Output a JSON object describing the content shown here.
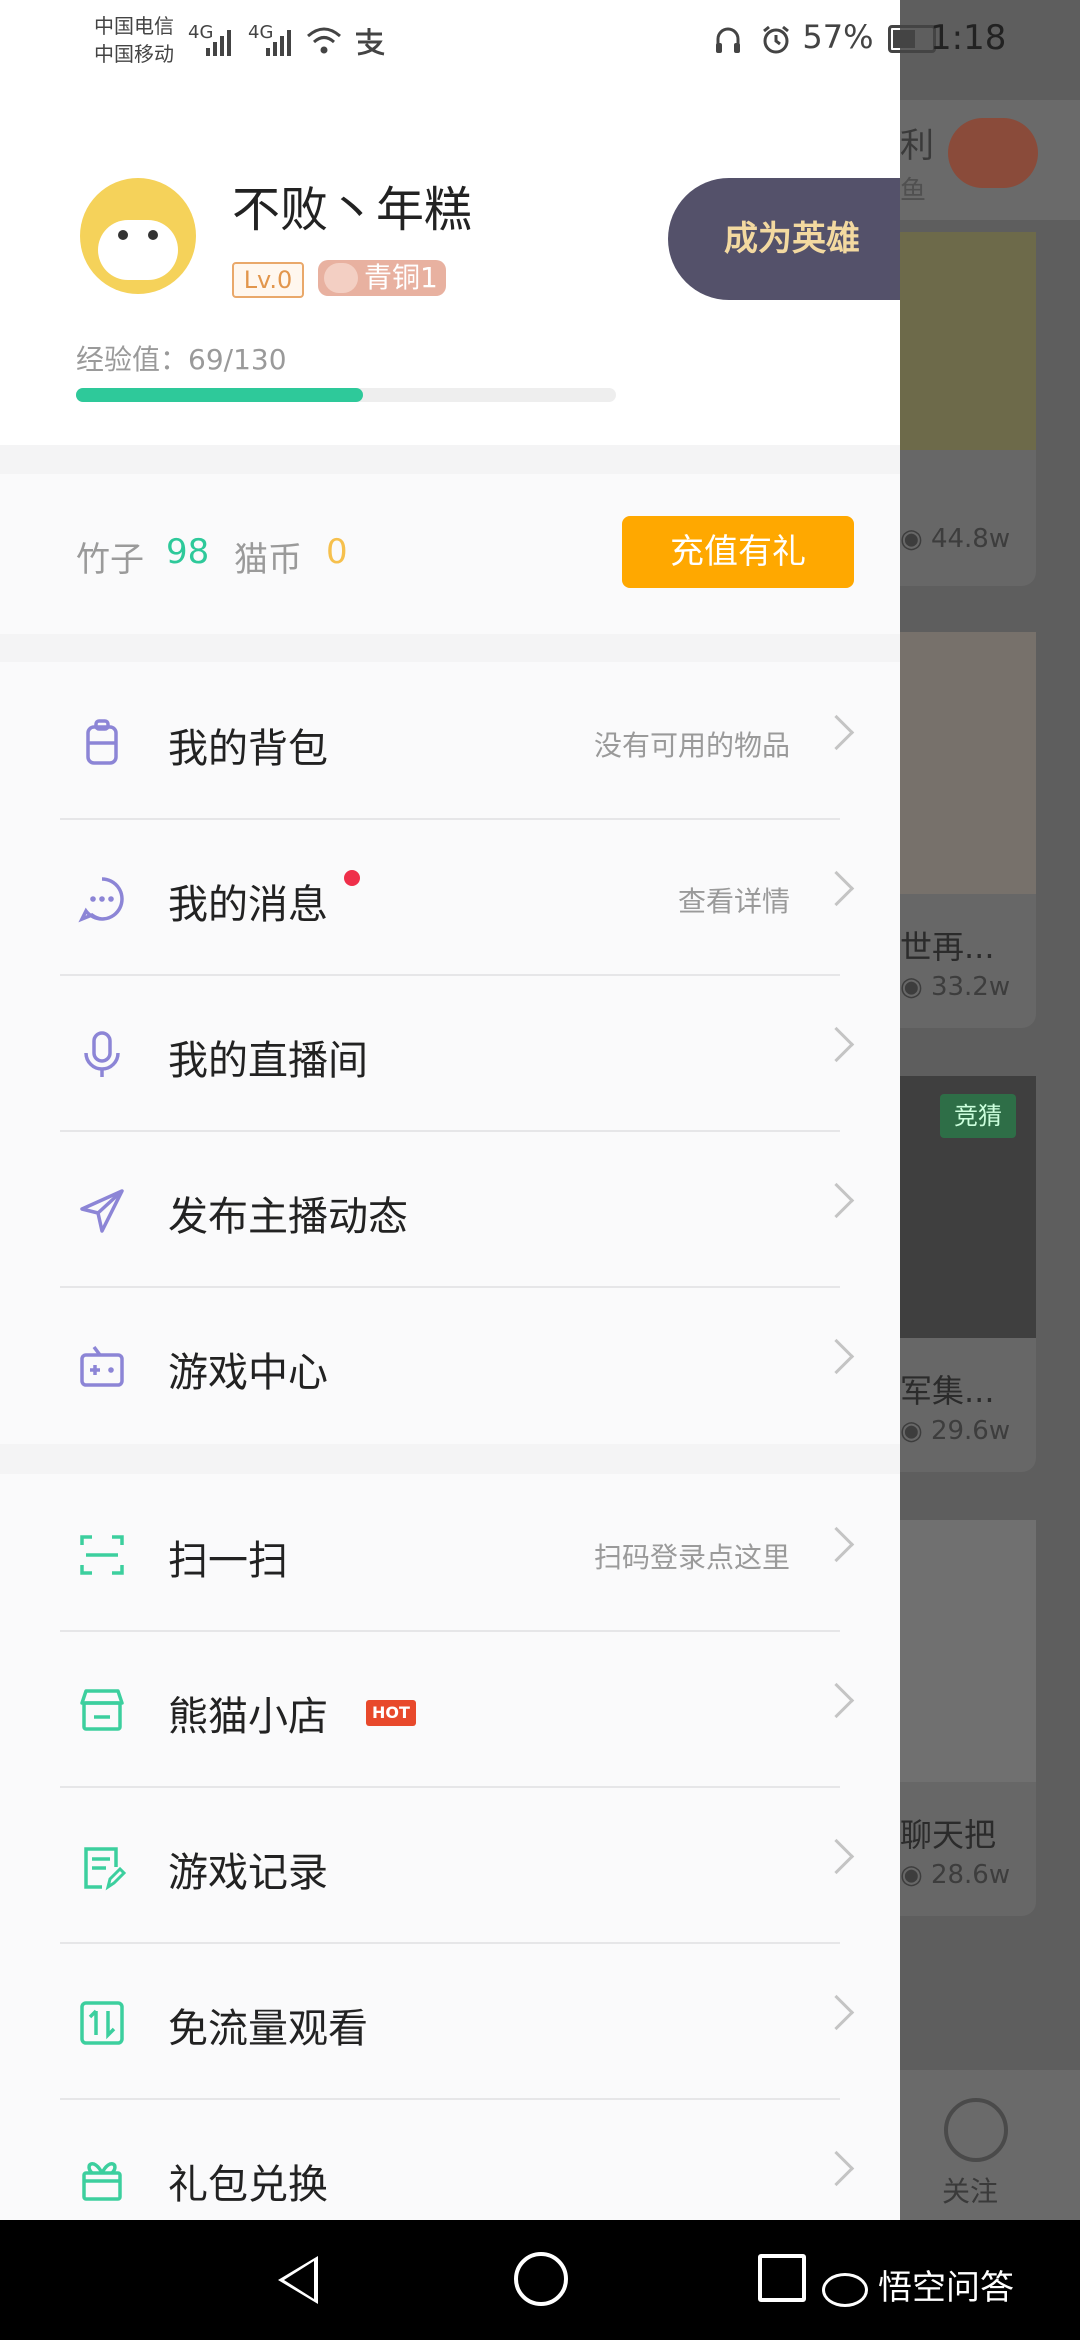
{
  "status_bar": {
    "carrier1": "中国电信",
    "carrier2": "中国移动",
    "net1": "4G",
    "net2": "4G",
    "battery": "57%",
    "time": "1:18"
  },
  "background": {
    "top_text1": "利",
    "top_text2": "鱼",
    "card1_views": "44.8w",
    "card2_title": "世再...",
    "card2_views": "33.2w",
    "card3_badge": "竞猜",
    "card3_title": "军集...",
    "card3_views": "29.6w",
    "card4_title": "聊天把",
    "card4_views": "28.6w",
    "tab_follow": "关注"
  },
  "profile": {
    "username": "不败丶年糕",
    "level": "Lv.0",
    "rank": "青铜1",
    "hero_button": "成为英雄",
    "exp_label": "经验值：69/130",
    "exp_current": 69,
    "exp_total": 130
  },
  "wallet": {
    "bamboo_label": "竹子",
    "bamboo_value": "98",
    "coin_label": "猫币",
    "coin_value": "0",
    "recharge_button": "充值有礼"
  },
  "menu_group1": [
    {
      "label": "我的背包",
      "sub": "没有可用的物品",
      "icon": "backpack-icon"
    },
    {
      "label": "我的消息",
      "sub": "查看详情",
      "icon": "message-icon"
    },
    {
      "label": "我的直播间",
      "sub": "",
      "icon": "microphone-icon"
    },
    {
      "label": "发布主播动态",
      "sub": "",
      "icon": "send-icon"
    },
    {
      "label": "游戏中心",
      "sub": "",
      "icon": "gamepad-icon"
    }
  ],
  "menu_group2": [
    {
      "label": "扫一扫",
      "sub": "扫码登录点这里",
      "icon": "scan-icon"
    },
    {
      "label": "熊猫小店",
      "sub": "",
      "badge": "HOT",
      "icon": "shop-icon"
    },
    {
      "label": "游戏记录",
      "sub": "",
      "icon": "record-icon"
    },
    {
      "label": "免流量观看",
      "sub": "",
      "icon": "data-free-icon"
    },
    {
      "label": "礼包兑换",
      "sub": "",
      "icon": "gift-icon"
    }
  ],
  "colors": {
    "accent_green": "#2ec99a",
    "recharge_orange": "#ffa800",
    "hero_bg": "#54516a",
    "icon_purple": "#8c85d6",
    "icon_green": "#3ccf9e"
  },
  "watermark": "悟空问答"
}
